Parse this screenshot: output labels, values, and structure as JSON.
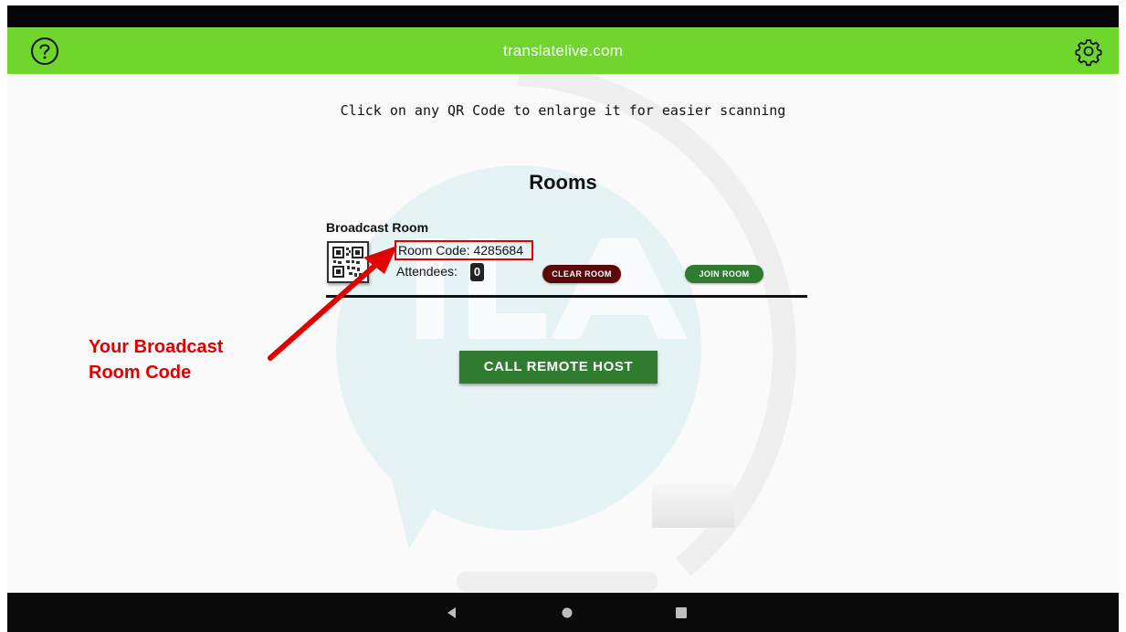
{
  "appbar": {
    "title": "translatelive.com",
    "help_icon": "help-circle-icon",
    "settings_icon": "gear-icon"
  },
  "main": {
    "hint": "Click on any QR Code to enlarge it for easier scanning",
    "rooms_title": "Rooms",
    "room": {
      "name": "Broadcast Room",
      "code_text": "Room Code: 4285684",
      "attendees_label": "Attendees:",
      "attendees_count": "0",
      "clear_label": "CLEAR ROOM",
      "join_label": "JOIN ROOM"
    },
    "call_button": "CALL REMOTE HOST"
  },
  "annotation": {
    "line1": "Your Broadcast",
    "line2": "Room Code"
  },
  "navbar": {
    "back_icon": "back-triangle-icon",
    "home_icon": "home-circle-icon",
    "recent_icon": "recent-apps-square-icon"
  },
  "colors": {
    "appbar": "#6ed62c",
    "accent_green": "#2f7b2f",
    "clear_red": "#5a0a0a",
    "annotation_red": "#e10000"
  }
}
